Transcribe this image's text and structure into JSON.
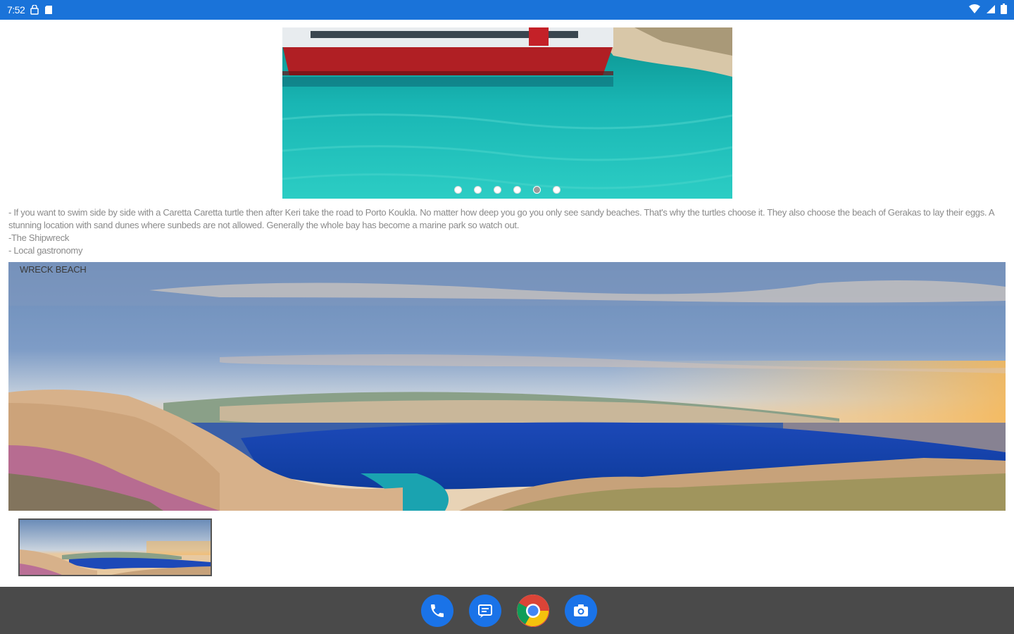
{
  "status_bar": {
    "time": "7:52",
    "left_icons": [
      "vpn-icon",
      "sd-card-icon"
    ],
    "right_icons": [
      "wifi-icon",
      "signal-icon",
      "battery-icon"
    ],
    "color": "#1a73d9"
  },
  "carousel": {
    "dot_count": 6,
    "active_index": 4
  },
  "description": {
    "lines": [
      "- If you want to swim side by side with a Caretta Caretta turtle then after Keri take the road to Porto Koukla. No matter how deep you go you only see sandy beaches. That's why the turtles choose it. They also choose the beach of Gerakas to lay their eggs. A stunning location with sand dunes where sunbeds are not allowed. Generally the whole bay has become a marine park so watch out.",
      "-The Shipwreck",
      "- Local gastronomy"
    ]
  },
  "banner": {
    "label": "WRECK BEACH"
  },
  "dock": {
    "apps": [
      {
        "name": "phone-app",
        "icon": "phone-icon"
      },
      {
        "name": "messages-app",
        "icon": "messages-icon"
      },
      {
        "name": "chrome-app",
        "icon": "chrome-icon"
      },
      {
        "name": "camera-app",
        "icon": "camera-icon"
      }
    ],
    "color": "#4a4a4a"
  }
}
